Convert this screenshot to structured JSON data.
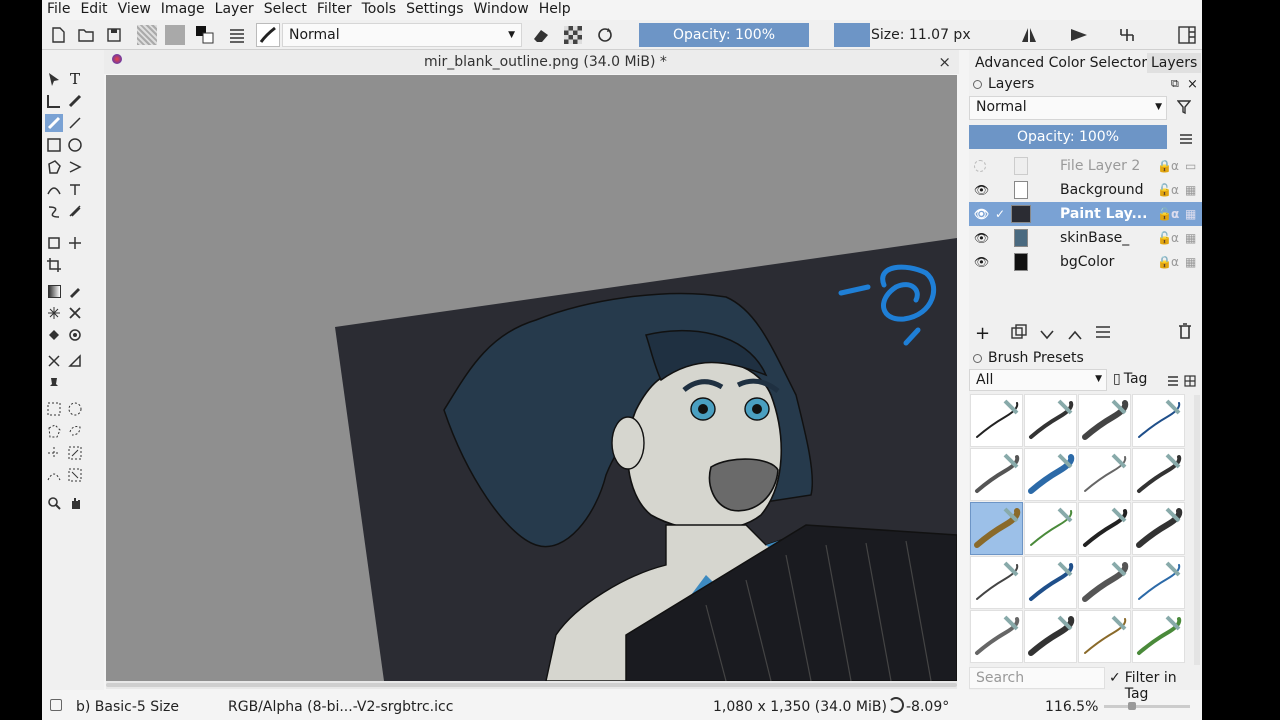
{
  "menu": [
    "File",
    "Edit",
    "View",
    "Image",
    "Layer",
    "Select",
    "Filter",
    "Tools",
    "Settings",
    "Window",
    "Help"
  ],
  "toolbar": {
    "blend_mode": "Normal",
    "opacity": "Opacity: 100%",
    "size": "Size: 11.07 px"
  },
  "document": {
    "tab_title": "mir_blank_outline.png (34.0 MiB) *",
    "close": "×"
  },
  "docker": {
    "tabs": [
      "Advanced Color Selector",
      "Layers"
    ],
    "layers_title": "Layers",
    "blend_mode": "Normal",
    "opacity": "Opacity:  100%",
    "layers": [
      {
        "name": "File Layer 2",
        "visible": false,
        "selected": false
      },
      {
        "name": "Background",
        "visible": true,
        "selected": false
      },
      {
        "name": "Paint Lay...",
        "visible": true,
        "selected": true
      },
      {
        "name": "skinBase_",
        "visible": true,
        "selected": false
      },
      {
        "name": "bgColor",
        "visible": true,
        "selected": false
      }
    ],
    "brush_presets_title": "Brush Presets",
    "brush_filter": "All",
    "tag_label": "Tag",
    "search_placeholder": "Search",
    "filter_in_tag": "Filter in Tag"
  },
  "status": {
    "brush": "b) Basic-5 Size",
    "color_space": "RGB/Alpha (8-bi...-V2-srgbtrc.icc",
    "dimensions": "1,080 x 1,350 (34.0 MiB)",
    "rotation": "-8.09°",
    "zoom": "116.5%"
  },
  "colors": {
    "accent": "#6d95c6",
    "selection": "#7aa2d4",
    "canvas_bg": "#8f8f8f",
    "art_bg": "#2b2c33",
    "sketch_blue": "#1f7fd6"
  }
}
